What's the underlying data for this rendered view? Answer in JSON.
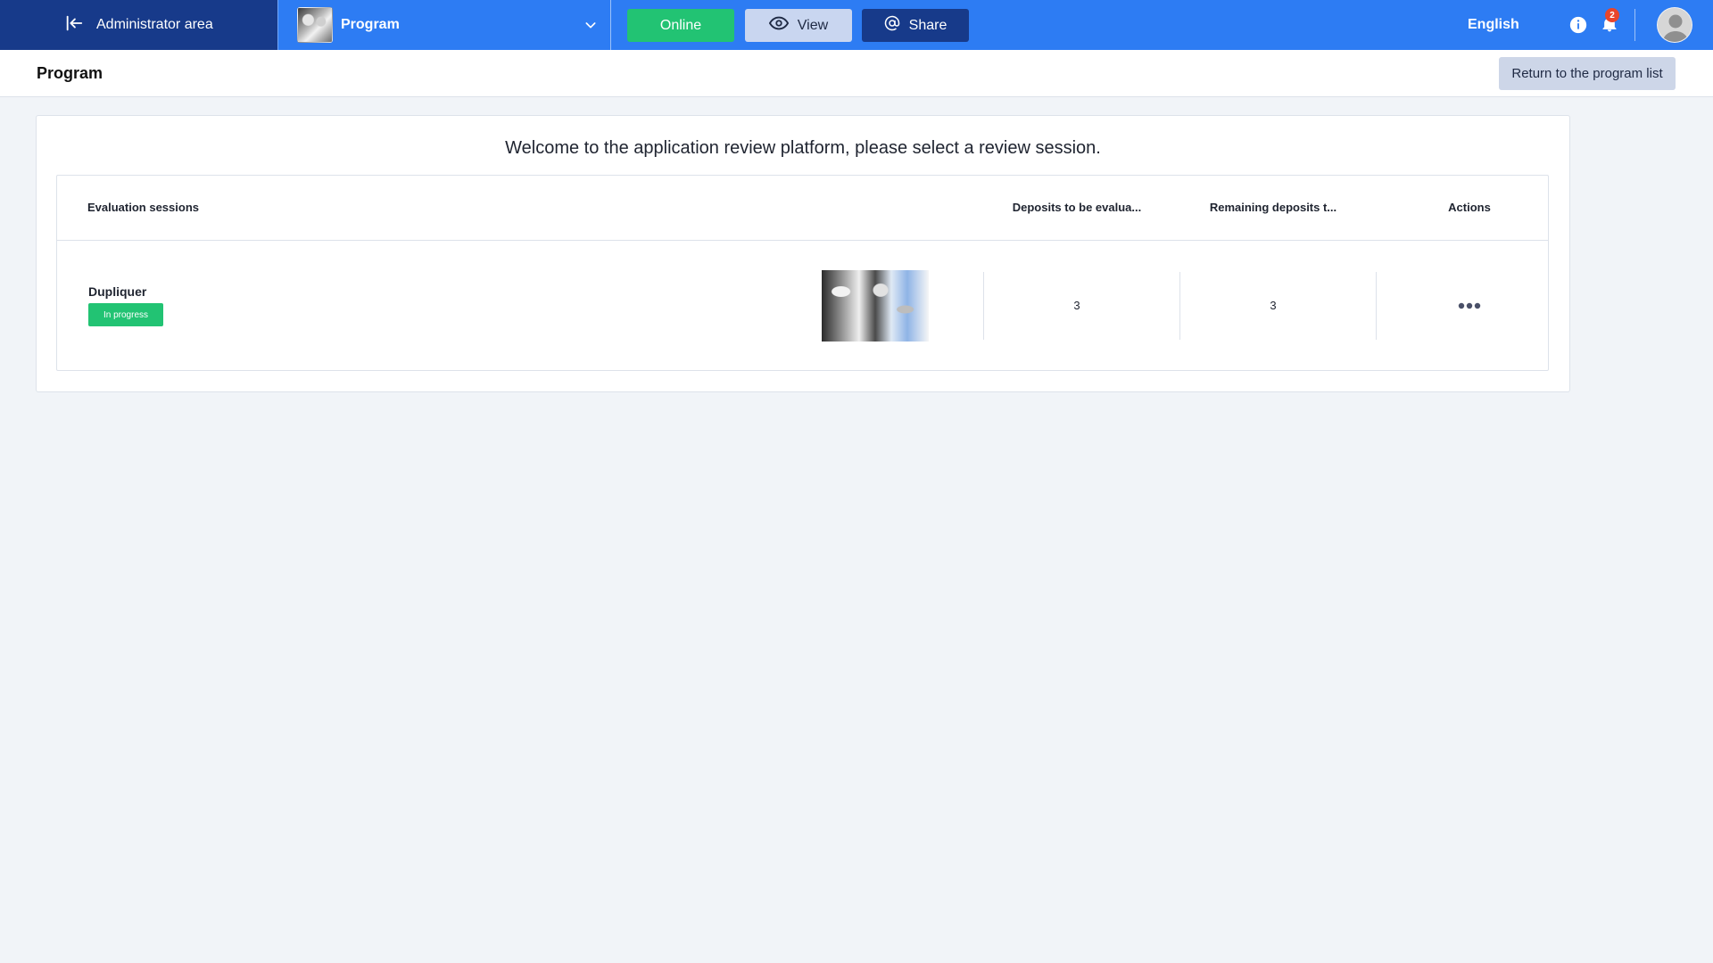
{
  "topbar": {
    "admin_label": "Administrator area",
    "program_label": "Program",
    "online_label": "Online",
    "view_label": "View",
    "share_label": "Share",
    "language": "English",
    "notification_count": "2"
  },
  "header": {
    "title": "Program",
    "return_label": "Return to the program list"
  },
  "main": {
    "welcome": "Welcome to the application review platform, please select a review session.",
    "table": {
      "columns": [
        "Evaluation sessions",
        "Deposits to be evalua...",
        "Remaining deposits t...",
        "Actions"
      ],
      "rows": [
        {
          "name": "Dupliquer",
          "status": "In progress",
          "deposits": "3",
          "remaining": "3"
        }
      ]
    }
  },
  "colors": {
    "topbar": "#2d7cf3",
    "admin_area": "#173a8a",
    "online": "#22c373",
    "share": "#173a8a",
    "badge": "#e8452b"
  },
  "icons": [
    "exit-icon",
    "chevron-down-icon",
    "eye-icon",
    "at-icon",
    "info-icon",
    "bell-icon",
    "avatar-icon",
    "more-icon"
  ]
}
